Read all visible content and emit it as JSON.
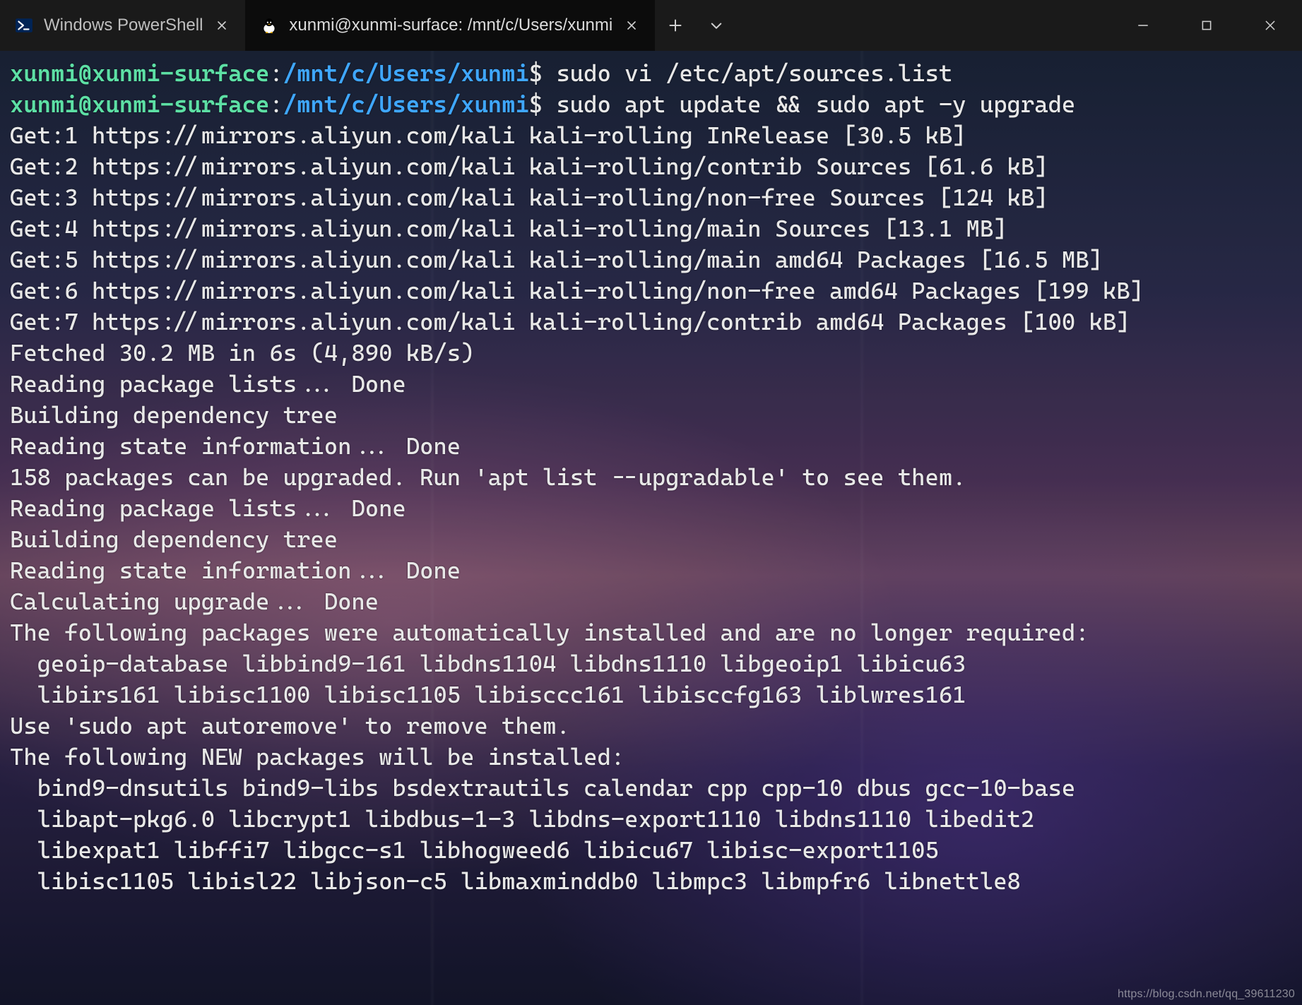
{
  "tabs": [
    {
      "label": "Windows PowerShell",
      "active": false,
      "icon": "powershell"
    },
    {
      "label": "xunmi@xunmi-surface: /mnt/c/Users/xunmi",
      "active": true,
      "icon": "tux"
    }
  ],
  "prompt": {
    "user_host": "xunmi@xunmi-surface",
    "sep": ":",
    "path": "/mnt/c/Users/xunmi",
    "sigil": "$"
  },
  "commands": [
    "sudo vi /etc/apt/sources.list",
    "sudo apt update && sudo apt -y upgrade"
  ],
  "output_lines": [
    "Get:1 https://mirrors.aliyun.com/kali kali-rolling InRelease [30.5 kB]",
    "Get:2 https://mirrors.aliyun.com/kali kali-rolling/contrib Sources [61.6 kB]",
    "Get:3 https://mirrors.aliyun.com/kali kali-rolling/non-free Sources [124 kB]",
    "Get:4 https://mirrors.aliyun.com/kali kali-rolling/main Sources [13.1 MB]",
    "Get:5 https://mirrors.aliyun.com/kali kali-rolling/main amd64 Packages [16.5 MB]",
    "Get:6 https://mirrors.aliyun.com/kali kali-rolling/non-free amd64 Packages [199 kB]",
    "Get:7 https://mirrors.aliyun.com/kali kali-rolling/contrib amd64 Packages [100 kB]",
    "Fetched 30.2 MB in 6s (4,890 kB/s)",
    "Reading package lists... Done",
    "Building dependency tree",
    "Reading state information... Done",
    "158 packages can be upgraded. Run 'apt list --upgradable' to see them.",
    "Reading package lists... Done",
    "Building dependency tree",
    "Reading state information... Done",
    "Calculating upgrade... Done",
    "The following packages were automatically installed and are no longer required:",
    "  geoip-database libbind9-161 libdns1104 libdns1110 libgeoip1 libicu63",
    "  libirs161 libisc1100 libisc1105 libisccc161 libisccfg163 liblwres161",
    "Use 'sudo apt autoremove' to remove them.",
    "The following NEW packages will be installed:",
    "  bind9-dnsutils bind9-libs bsdextrautils calendar cpp cpp-10 dbus gcc-10-base",
    "  libapt-pkg6.0 libcrypt1 libdbus-1-3 libdns-export1110 libdns1110 libedit2",
    "  libexpat1 libffi7 libgcc-s1 libhogweed6 libicu67 libisc-export1105",
    "  libisc1105 libisl22 libjson-c5 libmaxminddb0 libmpc3 libmpfr6 libnettle8"
  ],
  "watermark": "https://blog.csdn.net/qq_39611230"
}
